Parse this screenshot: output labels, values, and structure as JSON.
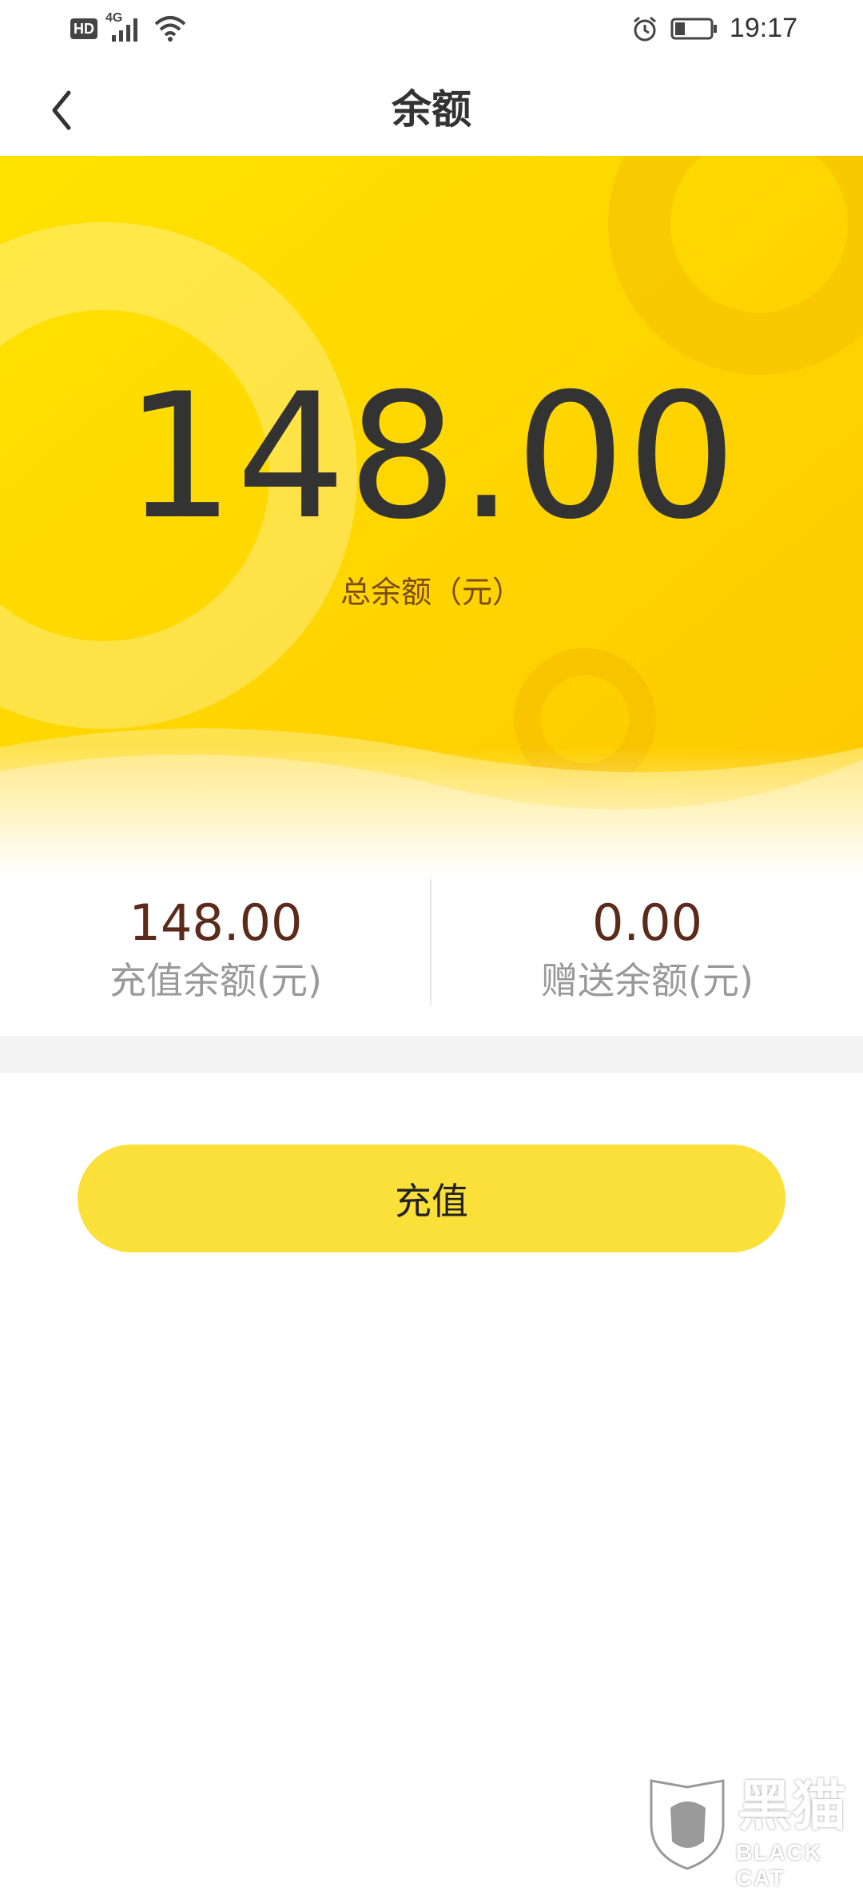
{
  "status_bar": {
    "network_badge": "HD",
    "network_type": "4G",
    "time": "19:17",
    "icons": [
      "hd-icon",
      "signal-icon",
      "wifi-icon",
      "alarm-icon",
      "battery-icon"
    ]
  },
  "nav": {
    "title": "余额",
    "back_icon": "chevron-left-icon"
  },
  "balance": {
    "total": "148.00",
    "total_label": "总余额（元）"
  },
  "breakdown": [
    {
      "value": "148.00",
      "label": "充值余额(元)"
    },
    {
      "value": "0.00",
      "label": "赠送余额(元)"
    }
  ],
  "actions": {
    "recharge_label": "充值"
  },
  "watermark": {
    "text": "黑猫",
    "subtext": "BLACK CAT",
    "icon": "black-cat-logo-icon"
  },
  "colors": {
    "hero_yellow": "#ffd500",
    "button_yellow": "#fbe03a",
    "value_brown": "#5b2a1a",
    "label_gray": "#999999"
  }
}
